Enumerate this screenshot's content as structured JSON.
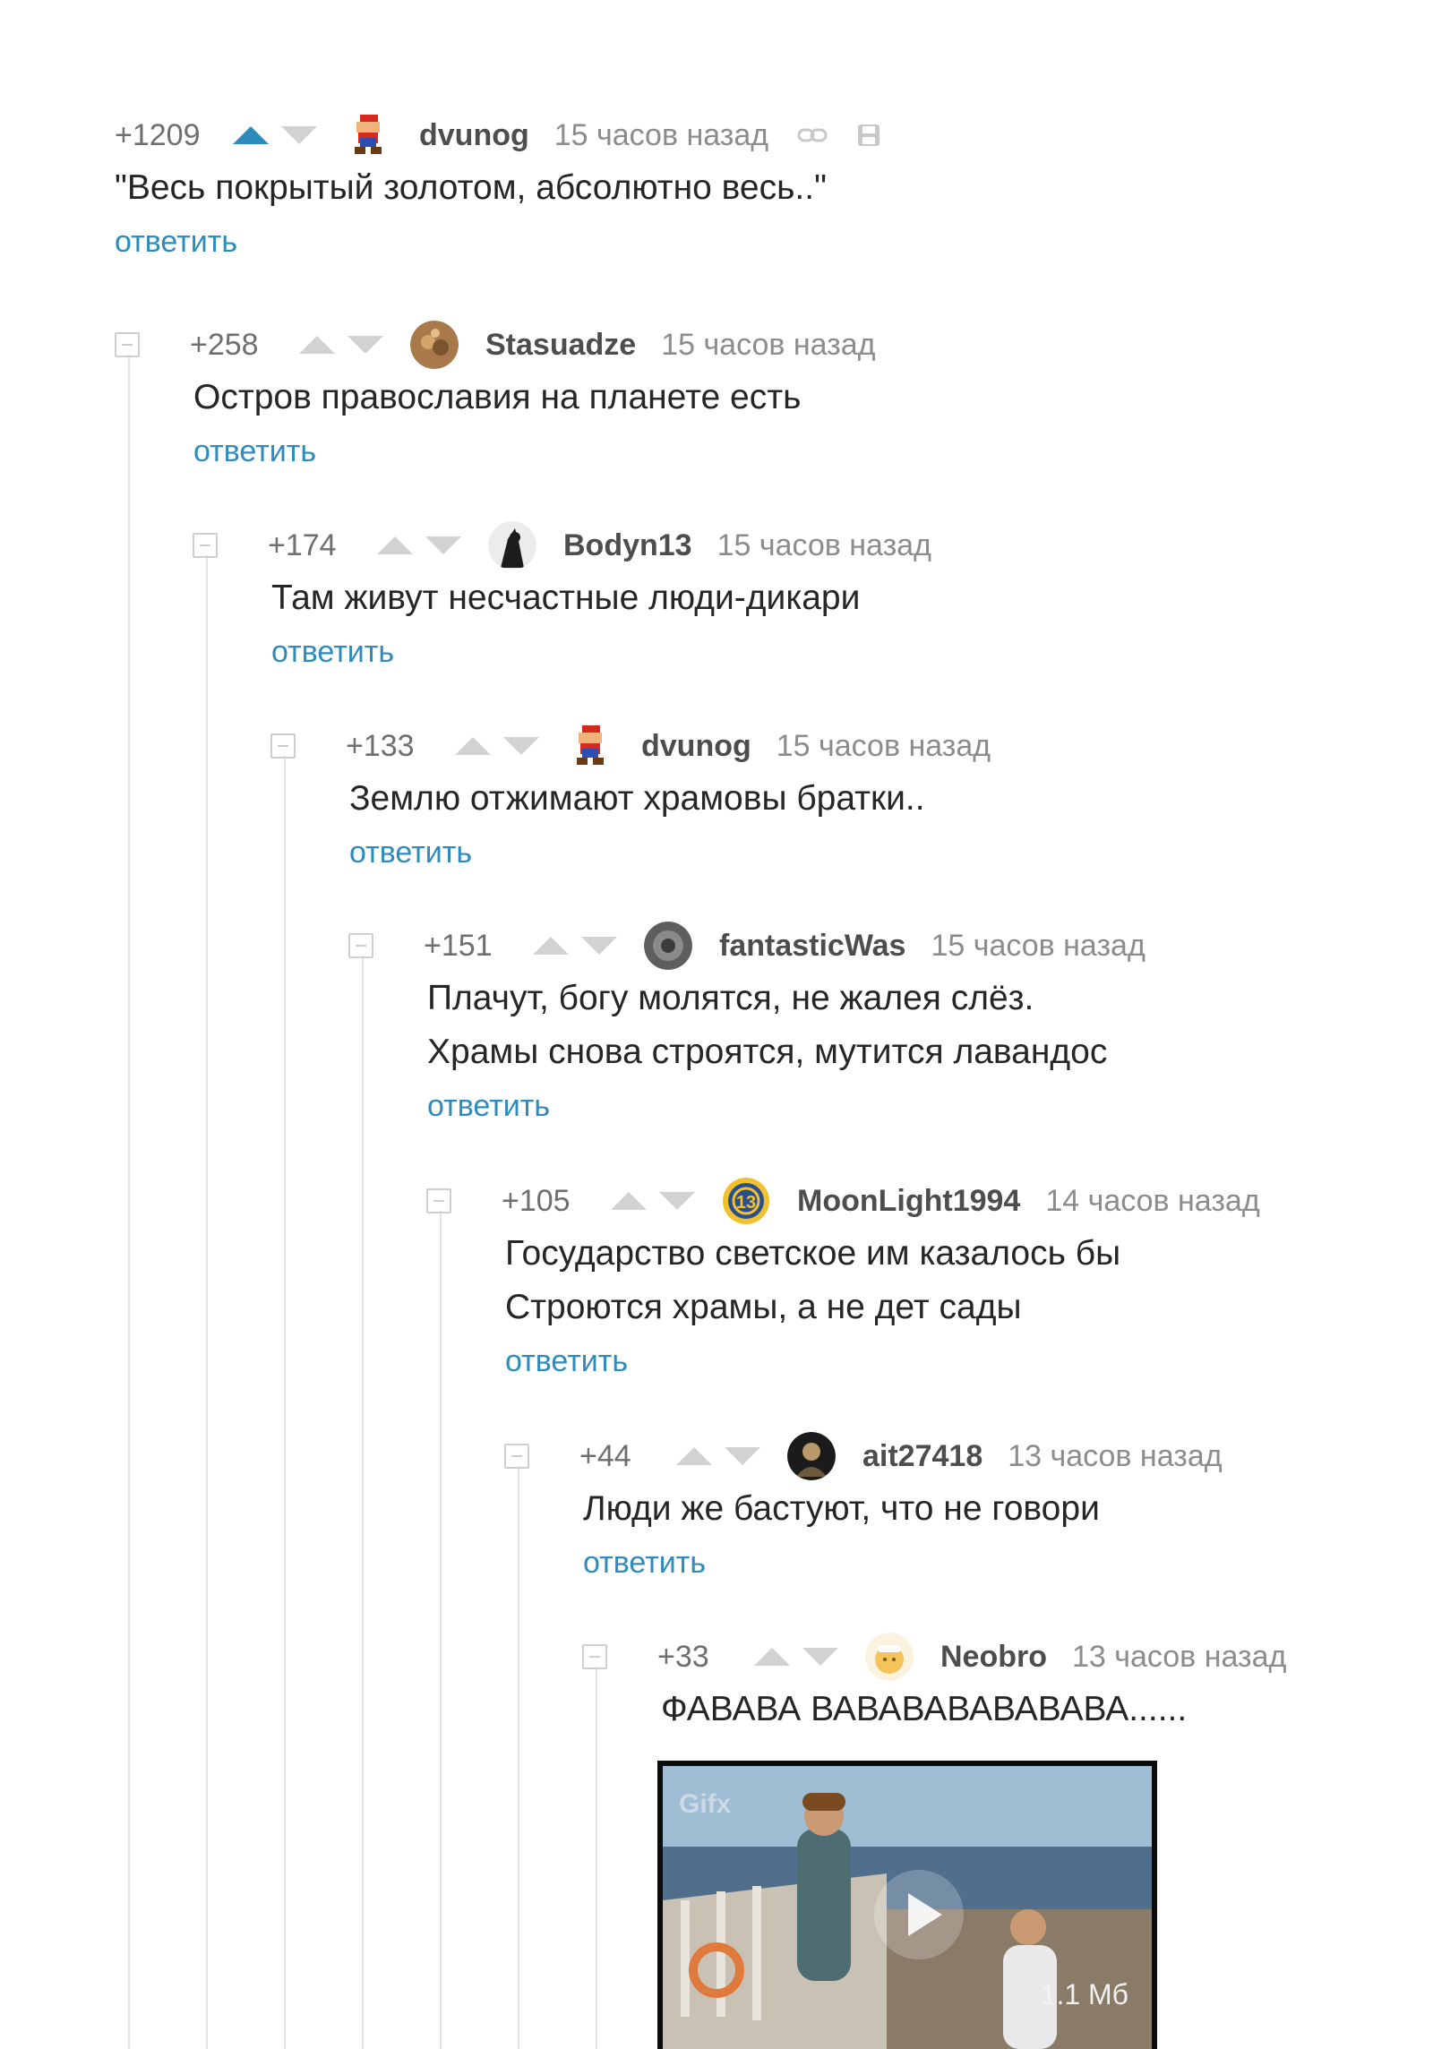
{
  "comments": [
    {
      "rating": "+1209",
      "author": "dvunog",
      "time": "15 часов назад",
      "lines": [
        "\"Весь покрытый золотом, абсолютно весь..\""
      ],
      "reply": "ответить"
    },
    {
      "rating": "+258",
      "author": "Stasuadze",
      "time": "15 часов назад",
      "lines": [
        "Остров православия на планете есть"
      ],
      "reply": "ответить"
    },
    {
      "rating": "+174",
      "author": "Bodyn13",
      "time": "15 часов назад",
      "lines": [
        "Там живут несчастные люди-дикари"
      ],
      "reply": "ответить"
    },
    {
      "rating": "+133",
      "author": "dvunog",
      "time": "15 часов назад",
      "lines": [
        "Землю отжимают храмовы братки.."
      ],
      "reply": "ответить"
    },
    {
      "rating": "+151",
      "author": "fantasticWas",
      "time": "15 часов назад",
      "lines": [
        "Плачут, богу молятся, не жалея слёз.",
        "Храмы снова строятся, мутится лавандос"
      ],
      "reply": "ответить"
    },
    {
      "rating": "+105",
      "author": "MoonLight1994",
      "time": "14 часов назад",
      "lines": [
        "Государство светское им казалось бы",
        "Строются храмы, а не дет сады"
      ],
      "reply": "ответить"
    },
    {
      "rating": "+44",
      "author": "ait27418",
      "time": "13 часов назад",
      "lines": [
        "Люди же бастуют, что не говори"
      ],
      "reply": "ответить"
    },
    {
      "rating": "+33",
      "author": "Neobro",
      "time": "13 часов назад",
      "lines": [
        "ФАВАВА ВАВАВАВАВАВАВА......"
      ],
      "reply": ""
    }
  ],
  "media": {
    "size_label": "1.1 Мб",
    "watermark": "Gifx"
  }
}
